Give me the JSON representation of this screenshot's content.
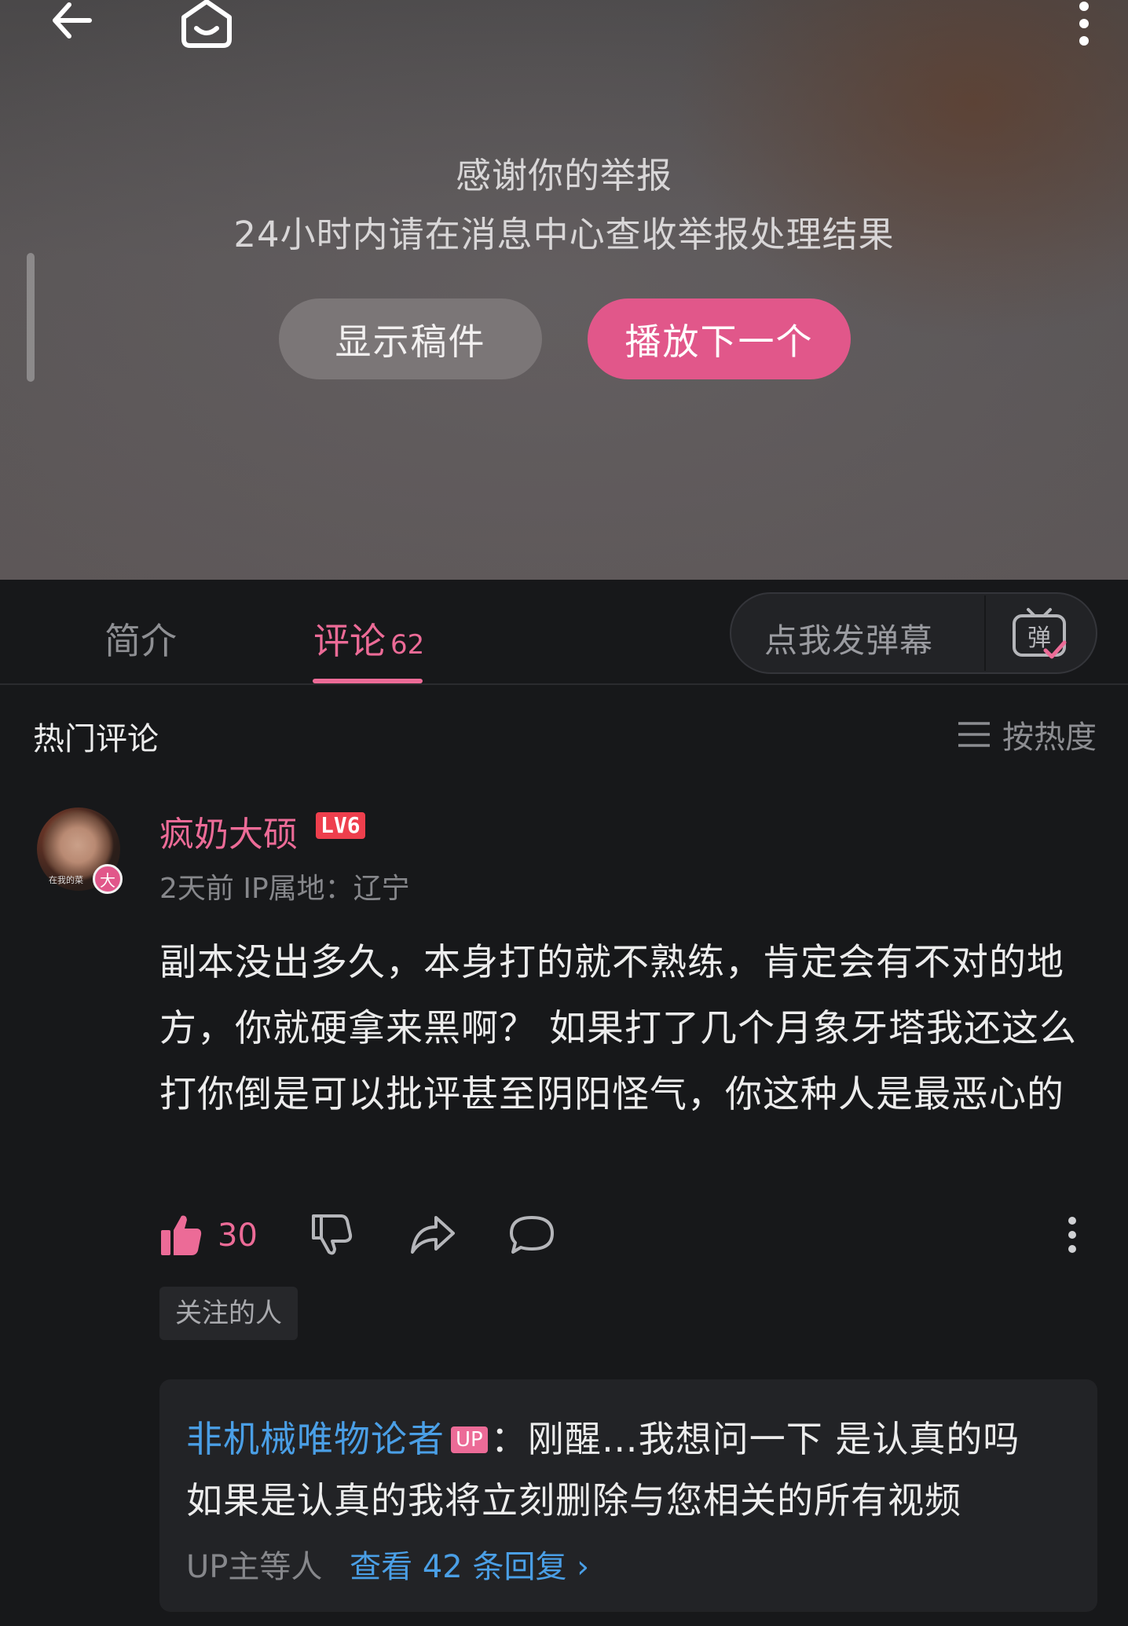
{
  "video": {
    "report_title": "感谢你的举报",
    "report_subtitle": "24小时内请在消息中心查收举报处理结果",
    "show_button": "显示稿件",
    "next_button": "播放下一个"
  },
  "tabs": {
    "intro": "简介",
    "comments": "评论",
    "comments_count": "62",
    "danmaku_placeholder": "点我发弹幕",
    "danmaku_icon_char": "弹"
  },
  "comments_header": {
    "title": "热门评论",
    "sort_label": "按热度"
  },
  "comment": {
    "avatar_caption": "在我的菜",
    "avatar_badge": "大",
    "username": "疯奶大硕",
    "level": "LV6",
    "meta": "2天前 IP属地：辽宁",
    "text": "副本没出多久，本身打的就不熟练，肯定会有不对的地方，你就硬拿来黑啊？  如果打了几个月象牙塔我还这么打你倒是可以批评甚至阴阳怪气，你这种人是最恶心的",
    "likes": "30",
    "tag": "关注的人"
  },
  "reply": {
    "author": "非机械唯物论者",
    "author_badge": "UP",
    "line1": "：刚醒…我想问一下 是认真的吗",
    "line2": "如果是认真的我将立刻删除与您相关的所有视频",
    "by": "UP主等人",
    "view_more": "查看 42 条回复",
    "view_more_arrow": "›"
  },
  "colors": {
    "accent_pink": "#ec6b97",
    "link_blue": "#4a9fe6",
    "background": "#17181a"
  },
  "icons": [
    "back-arrow-icon",
    "home-tv-icon",
    "more-vertical-icon",
    "danmaku-icon",
    "sort-lines-icon",
    "thumb-up-icon",
    "thumb-down-icon",
    "share-icon",
    "reply-bubble-icon"
  ]
}
